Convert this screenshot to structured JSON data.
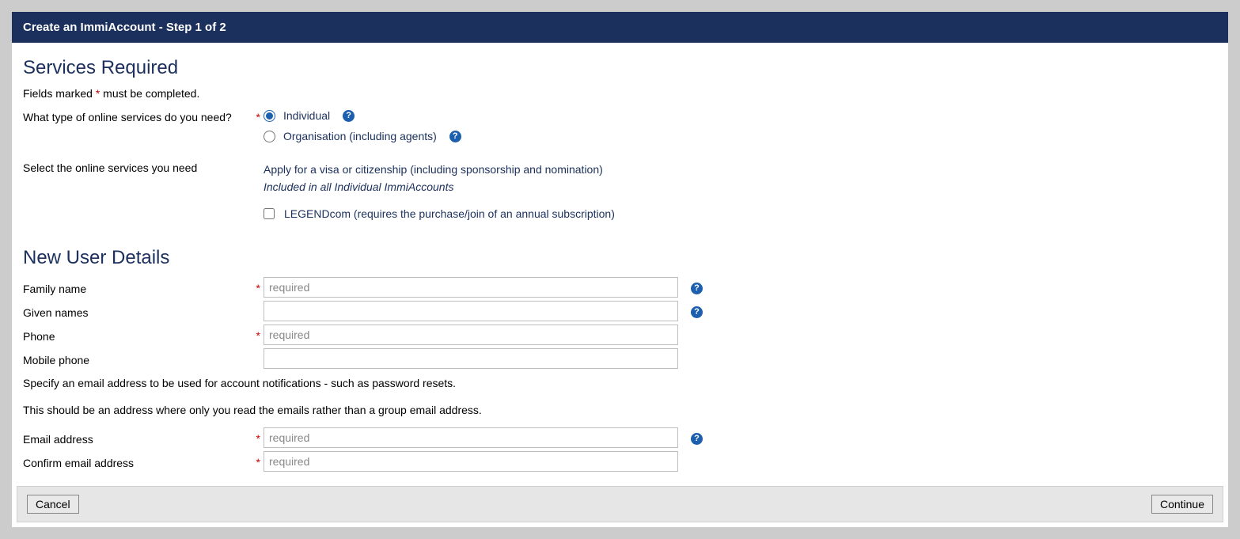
{
  "header": {
    "title": "Create an ImmiAccount - Step 1 of 2"
  },
  "servicesRequired": {
    "heading": "Services Required",
    "requiredNote_pre": "Fields marked ",
    "requiredNote_mark": "*",
    "requiredNote_post": " must be completed.",
    "serviceTypeLabel": "What type of online services do you need?",
    "radios": {
      "individual": "Individual",
      "organisation": "Organisation (including agents)"
    },
    "selectServicesLabel": "Select the online services you need",
    "visaDesc": "Apply for a visa or citizenship (including sponsorship and nomination)",
    "includedNote": "Included in all Individual ImmiAccounts",
    "legendcom": "LEGENDcom (requires the purchase/join of an annual subscription)"
  },
  "newUser": {
    "heading": "New User Details",
    "familyName": {
      "label": "Family name",
      "placeholder": "required"
    },
    "givenNames": {
      "label": "Given names",
      "placeholder": ""
    },
    "phone": {
      "label": "Phone",
      "placeholder": "required"
    },
    "mobile": {
      "label": "Mobile phone",
      "placeholder": ""
    },
    "emailInfo1": "Specify an email address to be used for account notifications - such as password resets.",
    "emailInfo2": "This should be an address where only you read the emails rather than a group email address.",
    "email": {
      "label": "Email address",
      "placeholder": "required"
    },
    "confirmEmail": {
      "label": "Confirm email address",
      "placeholder": "required"
    }
  },
  "buttons": {
    "cancel": "Cancel",
    "continue": "Continue"
  },
  "glyphs": {
    "help": "?"
  },
  "asterisk": "*"
}
